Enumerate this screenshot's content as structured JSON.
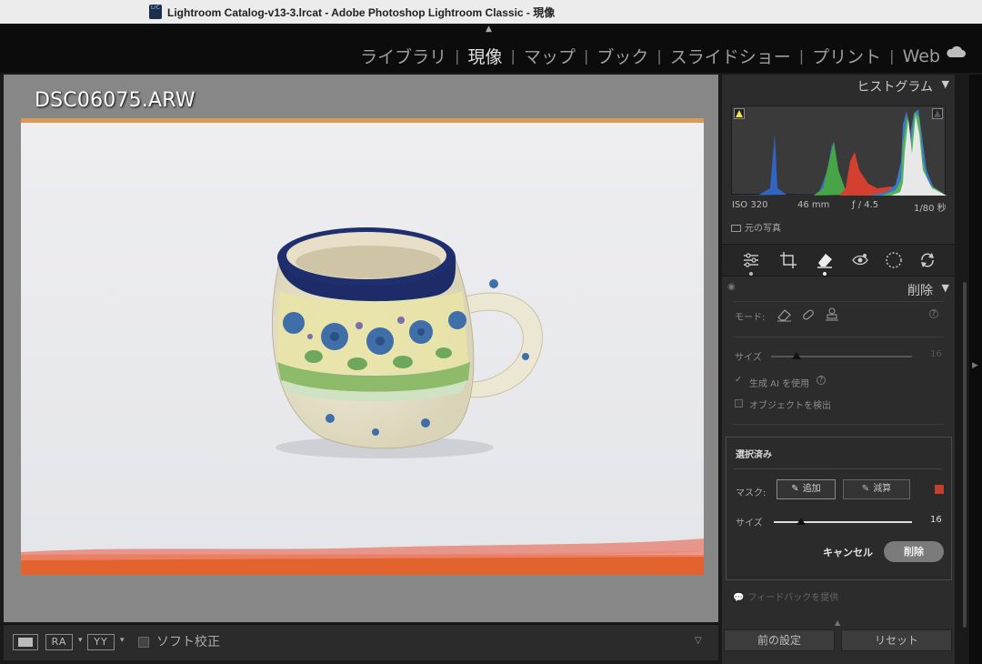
{
  "window": {
    "title": "Lightroom Catalog-v13-3.lrcat - Adobe Photoshop Lightroom Classic - 現像",
    "app_icon_text": "LrC"
  },
  "modules": [
    {
      "label": "ライブラリ",
      "active": false
    },
    {
      "label": "現像",
      "active": true
    },
    {
      "label": "マップ",
      "active": false
    },
    {
      "label": "ブック",
      "active": false
    },
    {
      "label": "スライドショー",
      "active": false
    },
    {
      "label": "プリント",
      "active": false
    },
    {
      "label": "Web",
      "active": false
    }
  ],
  "module_separator": "|",
  "viewer": {
    "filename": "DSC06075.ARW"
  },
  "toolbar": {
    "loupe_label": "",
    "ra_label": "RA",
    "yy_label": "YY",
    "soft_proof_label": "ソフト校正",
    "soft_proof_checked": false
  },
  "histogram": {
    "title": "ヒストグラム",
    "iso": "ISO 320",
    "focal": "46 mm",
    "aperture": "ƒ / 4.5",
    "shutter": "1/80 秒",
    "original_photo_label": "元の写真"
  },
  "tools": [
    {
      "name": "edit-sliders-icon",
      "active": false
    },
    {
      "name": "crop-icon",
      "active": false
    },
    {
      "name": "remove-eraser-icon",
      "active": true
    },
    {
      "name": "red-eye-icon",
      "active": false
    },
    {
      "name": "masking-icon",
      "active": false
    },
    {
      "name": "refresh-icon",
      "active": false
    }
  ],
  "remove_panel": {
    "title": "削除",
    "mode_label": "モード:",
    "size_label": "サイズ",
    "size_value": "16",
    "gen_ai_label": "生成 AI を使用",
    "gen_ai_checked": true,
    "detect_objects_label": "オブジェクトを検出",
    "detect_objects_checked": false
  },
  "selection": {
    "title": "選択済み",
    "mask_label": "マスク:",
    "add_label": "追加",
    "subtract_label": "減算",
    "size_label": "サイズ",
    "size_value": "16",
    "size_fraction": 0.2,
    "mask_color": "#c0412e",
    "cancel_label": "キャンセル",
    "delete_label": "削除"
  },
  "feedback_label": "フィードバックを提供",
  "bottom": {
    "previous_label": "前の設定",
    "reset_label": "リセット"
  },
  "colors": {
    "panel_bg": "#2c2c2c",
    "viewer_bg": "#878787",
    "mask_overlay": "#e8877a"
  }
}
